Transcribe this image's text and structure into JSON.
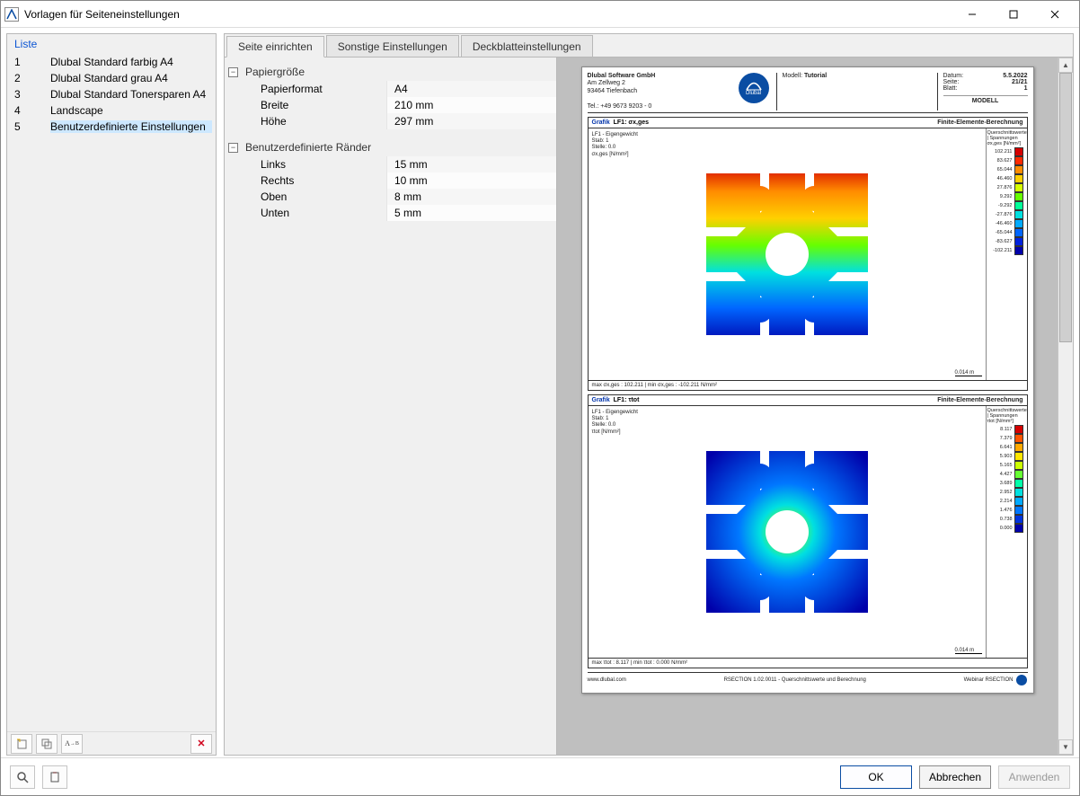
{
  "window": {
    "title": "Vorlagen für Seiteneinstellungen"
  },
  "sidebar": {
    "header": "Liste",
    "items": [
      {
        "num": "1",
        "name": "Dlubal Standard farbig A4"
      },
      {
        "num": "2",
        "name": "Dlubal Standard grau A4"
      },
      {
        "num": "3",
        "name": "Dlubal Standard Tonersparen A4"
      },
      {
        "num": "4",
        "name": "Landscape"
      },
      {
        "num": "5",
        "name": "Benutzerdefinierte Einstellungen"
      }
    ],
    "selected_index": 4
  },
  "tabs": [
    {
      "label": "Seite einrichten",
      "active": true
    },
    {
      "label": "Sonstige Einstellungen",
      "active": false
    },
    {
      "label": "Deckblatteinstellungen",
      "active": false
    }
  ],
  "props": {
    "paper": {
      "title": "Papiergröße",
      "rows": [
        {
          "key": "Papierformat",
          "val": "A4"
        },
        {
          "key": "Breite",
          "val": "210 mm"
        },
        {
          "key": "Höhe",
          "val": "297 mm"
        }
      ]
    },
    "margins": {
      "title": "Benutzerdefinierte Ränder",
      "rows": [
        {
          "key": "Links",
          "val": "15 mm"
        },
        {
          "key": "Rechts",
          "val": "10 mm"
        },
        {
          "key": "Oben",
          "val": "8 mm"
        },
        {
          "key": "Unten",
          "val": "5 mm"
        }
      ]
    }
  },
  "preview": {
    "header": {
      "company": "Dlubal Software GmbH",
      "addr1": "Am Zellweg 2",
      "addr2": "93464 Tiefenbach",
      "tel": "Tel.: +49 9673 9203 - 0",
      "logo": "Dlubal",
      "modell_label": "Modell:",
      "modell_value": "Tutorial",
      "date_label": "Datum:",
      "date_value": "5.5.2022",
      "page_label": "Seite:",
      "page_value": "21/21",
      "sheet_label": "Blatt:",
      "sheet_value": "1",
      "modell_big": "MODELL"
    },
    "block1": {
      "grafik_label": "Grafik",
      "title": "LF1: σx,ges",
      "right": "Finite-Elemente-Berechnung",
      "info": "LF1 - Eigengewicht\nStab: 1\nStelle: 0.0\nσx,ges [N/mm²]",
      "legend_title": "Querschnittswerte | Spannungen\nσx,ges [N/mm²]",
      "legend": [
        {
          "v": "102.211",
          "c": "#d40000"
        },
        {
          "v": "83.627",
          "c": "#ff2a00"
        },
        {
          "v": "65.044",
          "c": "#ff8c00"
        },
        {
          "v": "46.460",
          "c": "#ffd000"
        },
        {
          "v": "27.876",
          "c": "#d6ff00"
        },
        {
          "v": "9.292",
          "c": "#66ff00"
        },
        {
          "v": "-9.292",
          "c": "#00ff99"
        },
        {
          "v": "-27.876",
          "c": "#00e0e0"
        },
        {
          "v": "-46.460",
          "c": "#00aaff"
        },
        {
          "v": "-65.044",
          "c": "#0066ff"
        },
        {
          "v": "-83.627",
          "c": "#0022dd"
        },
        {
          "v": "-102.211",
          "c": "#0000aa"
        }
      ],
      "footer": "max σx,ges : 102.211 | min σx,ges : -102.211 N/mm²",
      "scale": "0.014 m"
    },
    "block2": {
      "grafik_label": "Grafik",
      "title": "LF1: τtot",
      "right": "Finite-Elemente-Berechnung",
      "info": "LF1 - Eigengewicht\nStab: 1\nStelle: 0.0\nτtot [N/mm²]",
      "legend_title": "Querschnittswerte | Spannungen\nτtot [N/mm²]",
      "legend": [
        {
          "v": "8.117",
          "c": "#d40000"
        },
        {
          "v": "7.379",
          "c": "#ff5500"
        },
        {
          "v": "6.641",
          "c": "#ffaa00"
        },
        {
          "v": "5.903",
          "c": "#ffe600"
        },
        {
          "v": "5.165",
          "c": "#ccff00"
        },
        {
          "v": "4.427",
          "c": "#66ff33"
        },
        {
          "v": "3.689",
          "c": "#00ffaa"
        },
        {
          "v": "2.952",
          "c": "#00e0e0"
        },
        {
          "v": "2.214",
          "c": "#00aaff"
        },
        {
          "v": "1.476",
          "c": "#0077ff"
        },
        {
          "v": "0.738",
          "c": "#0033dd"
        },
        {
          "v": "0.000",
          "c": "#0000aa"
        }
      ],
      "footer": "max τtot : 8.117 | min τtot : 0.000 N/mm²",
      "scale": "0.014 m"
    },
    "page_footer": {
      "left": "www.dlubal.com",
      "mid": "RSECTION 1.02.0011 - Querschnittswerte und Berechnung",
      "right": "Webinar RSECTION"
    }
  },
  "buttons": {
    "ok": "OK",
    "cancel": "Abbrechen",
    "apply": "Anwenden"
  }
}
